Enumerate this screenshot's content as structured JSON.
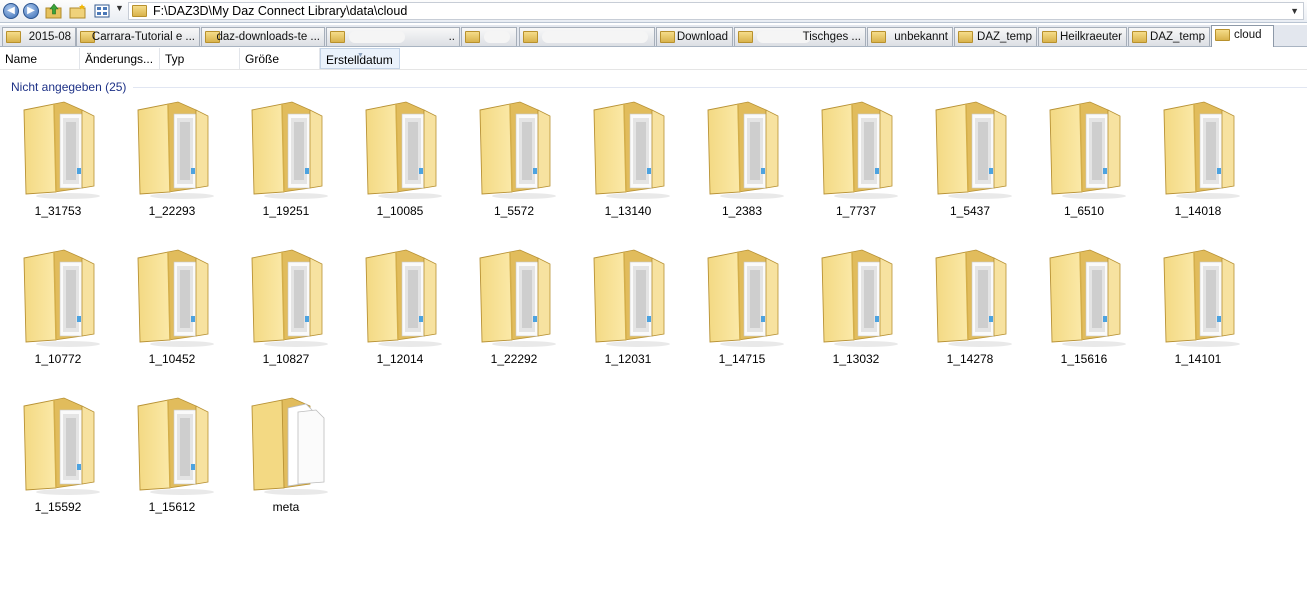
{
  "window": {
    "address_path": "F:\\DAZ3D\\My Daz Connect Library\\data\\cloud"
  },
  "tabs": [
    {
      "label": "2015-08",
      "redacted": false,
      "active": false
    },
    {
      "label": "Carrara-Tutorial e ...",
      "redacted": false,
      "active": false
    },
    {
      "label": "daz-downloads-te ...",
      "redacted": false,
      "active": false
    },
    {
      "label": "..",
      "redacted": true,
      "active": false
    },
    {
      "label": "",
      "redacted": true,
      "active": false
    },
    {
      "label": "",
      "redacted": true,
      "active": false
    },
    {
      "label": "Download",
      "redacted": false,
      "active": false
    },
    {
      "label": "Tischges ...",
      "redacted": true,
      "active": false
    },
    {
      "label": "unbekannt",
      "redacted": false,
      "active": false
    },
    {
      "label": "DAZ_temp",
      "redacted": false,
      "active": false
    },
    {
      "label": "Heilkraeuter",
      "redacted": false,
      "active": false
    },
    {
      "label": "DAZ_temp",
      "redacted": false,
      "active": false
    },
    {
      "label": "cloud",
      "redacted": false,
      "active": true
    }
  ],
  "columns": [
    {
      "label": "Name",
      "sorted": false
    },
    {
      "label": "Änderungs...",
      "sorted": false
    },
    {
      "label": "Typ",
      "sorted": false
    },
    {
      "label": "Größe",
      "sorted": false
    },
    {
      "label": "Erstelldatum",
      "sorted": true
    }
  ],
  "group": {
    "label": "Nicht angegeben (25)"
  },
  "items": [
    {
      "name": "1_31753",
      "type": "folder-docs"
    },
    {
      "name": "1_22293",
      "type": "folder-docs"
    },
    {
      "name": "1_19251",
      "type": "folder-docs"
    },
    {
      "name": "1_10085",
      "type": "folder-docs"
    },
    {
      "name": "1_5572",
      "type": "folder-docs"
    },
    {
      "name": "1_13140",
      "type": "folder-docs"
    },
    {
      "name": "1_2383",
      "type": "folder-docs"
    },
    {
      "name": "1_7737",
      "type": "folder-docs"
    },
    {
      "name": "1_5437",
      "type": "folder-docs"
    },
    {
      "name": "1_6510",
      "type": "folder-docs"
    },
    {
      "name": "1_14018",
      "type": "folder-docs"
    },
    {
      "name": "1_10772",
      "type": "folder-docs"
    },
    {
      "name": "1_10452",
      "type": "folder-docs"
    },
    {
      "name": "1_10827",
      "type": "folder-docs"
    },
    {
      "name": "1_12014",
      "type": "folder-docs"
    },
    {
      "name": "1_22292",
      "type": "folder-docs"
    },
    {
      "name": "1_12031",
      "type": "folder-docs"
    },
    {
      "name": "1_14715",
      "type": "folder-docs"
    },
    {
      "name": "1_13032",
      "type": "folder-docs"
    },
    {
      "name": "1_14278",
      "type": "folder-docs"
    },
    {
      "name": "1_15616",
      "type": "folder-docs"
    },
    {
      "name": "1_14101",
      "type": "folder-docs"
    },
    {
      "name": "1_15592",
      "type": "folder-docs"
    },
    {
      "name": "1_15612",
      "type": "folder-docs"
    },
    {
      "name": "meta",
      "type": "folder-files"
    }
  ],
  "colors": {
    "group_label": "#1e3287",
    "folder_front": "#f3d983",
    "folder_back": "#e1bc5c"
  }
}
